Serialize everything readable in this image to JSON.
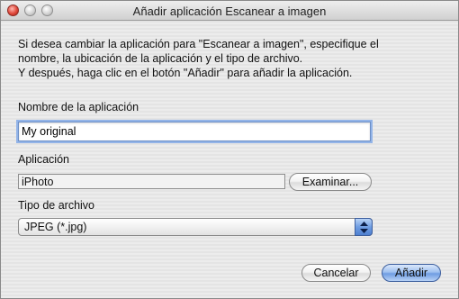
{
  "window": {
    "title": "Añadir aplicación Escanear a imagen"
  },
  "intro": {
    "lines": [
      "Si desea cambiar la aplicación para \"Escanear a imagen\", especifique el",
      "nombre, la ubicación de la aplicación y el tipo de archivo.",
      "Y después, haga clic en el botón \"Añadir\" para añadir la aplicación."
    ]
  },
  "app_name": {
    "label": "Nombre de la aplicación",
    "value": "My original"
  },
  "application": {
    "label": "Aplicación",
    "value": "iPhoto",
    "browse_label": "Examinar..."
  },
  "file_type": {
    "label": "Tipo de archivo",
    "selected": "JPEG (*.jpg)"
  },
  "buttons": {
    "cancel": "Cancelar",
    "add": "Añadir"
  },
  "colors": {
    "accent": "#6f9de2",
    "focus_ring": "#93b4e8",
    "close_button": "#e0473a"
  },
  "icons": [
    "close-icon",
    "minimize-icon",
    "zoom-icon",
    "select-arrows-icon"
  ]
}
